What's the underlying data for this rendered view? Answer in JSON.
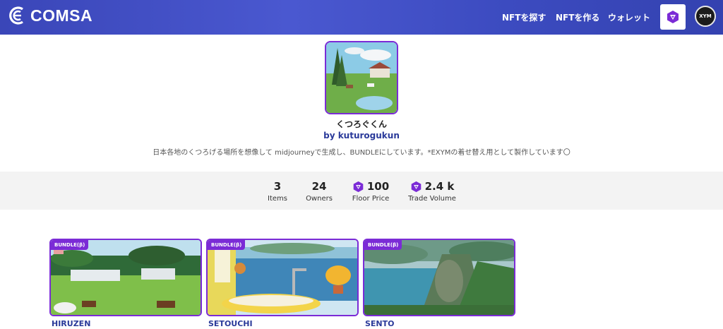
{
  "header": {
    "brand": "COMSA",
    "nav": [
      "NFTを探す",
      "NFTを作る",
      "ウォレット"
    ],
    "avatar_text": "XYM"
  },
  "profile": {
    "name": "くつろぐくん",
    "by": "by kuturogukun",
    "description": "日本各地のくつろげる場所を想像して midjourneyで生成し、BUNDLEにしています。*EXYMの着せ替え用として製作しています〇"
  },
  "stats": {
    "items": {
      "value": "3",
      "label": "Items"
    },
    "owners": {
      "value": "24",
      "label": "Owners"
    },
    "floor": {
      "value": "100",
      "label": "Floor Price"
    },
    "volume": {
      "value": "2.4 k",
      "label": "Trade Volume"
    }
  },
  "cards": [
    {
      "badge": "BUNDLE(β)",
      "title": "HIRUZEN"
    },
    {
      "badge": "BUNDLE(β)",
      "title": "SETOUCHI"
    },
    {
      "badge": "BUNDLE(β)",
      "title": "SENTO"
    }
  ],
  "colors": {
    "header_blue": "#3f4cc4",
    "accent_purple": "#7b2bd6",
    "link_blue": "#2a3a9a"
  }
}
